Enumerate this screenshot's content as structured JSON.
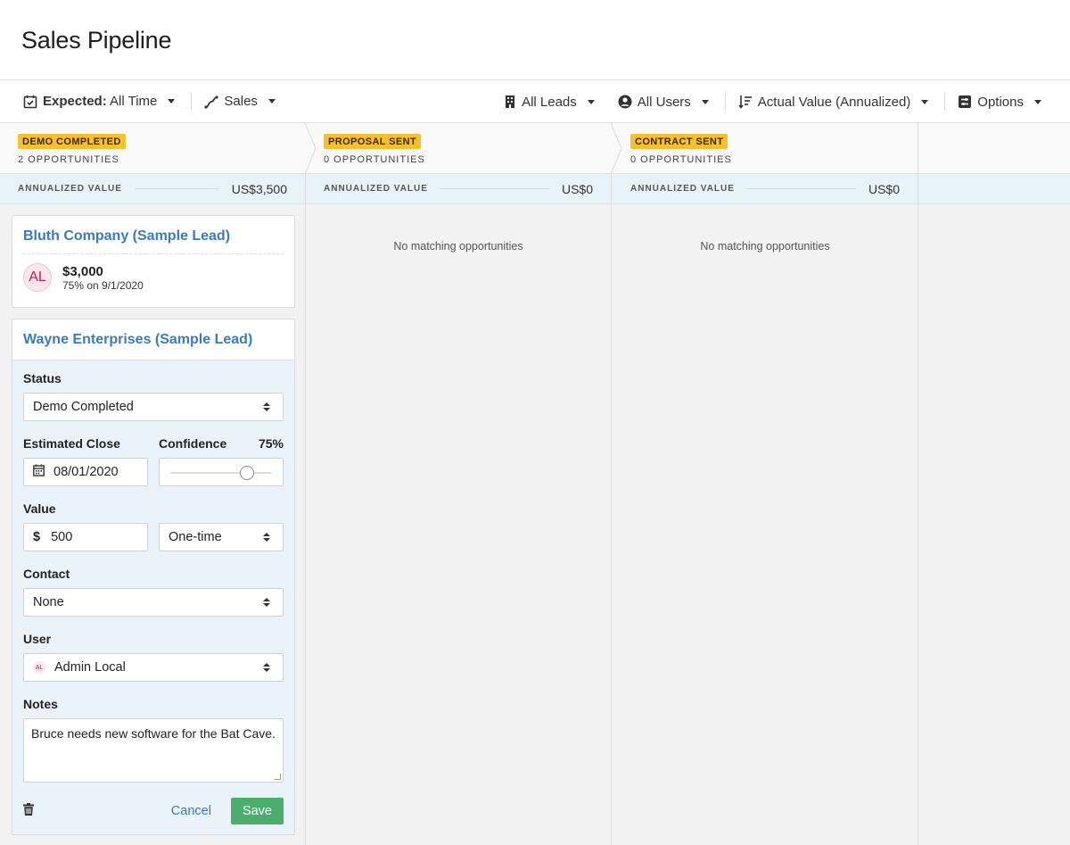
{
  "page": {
    "title": "Sales Pipeline"
  },
  "toolbar": {
    "expected_label": "Expected:",
    "expected_value": "All Time",
    "pipeline": "Sales",
    "leads": "All Leads",
    "users": "All Users",
    "sort": "Actual Value (Annualized)",
    "options": "Options"
  },
  "columns": [
    {
      "stage": "DEMO COMPLETED",
      "count": "2 OPPORTUNITIES",
      "value_label": "ANNUALIZED VALUE",
      "value": "US$3,500"
    },
    {
      "stage": "PROPOSAL SENT",
      "count": "0 OPPORTUNITIES",
      "value_label": "ANNUALIZED VALUE",
      "value": "US$0",
      "empty": "No matching opportunities"
    },
    {
      "stage": "CONTRACT SENT",
      "count": "0 OPPORTUNITIES",
      "value_label": "ANNUALIZED VALUE",
      "value": "US$0",
      "empty": "No matching opportunities"
    }
  ],
  "opportunity1": {
    "lead": "Bluth Company (Sample Lead)",
    "avatar": "AL",
    "amount": "$3,000",
    "detail": "75% on 9/1/2020"
  },
  "opportunity2": {
    "lead": "Wayne Enterprises (Sample Lead)",
    "form": {
      "status_label": "Status",
      "status_value": "Demo Completed",
      "close_label": "Estimated Close",
      "close_value": "08/01/2020",
      "confidence_label": "Confidence",
      "confidence_value": "75%",
      "confidence_fraction": 0.75,
      "value_label": "Value",
      "currency": "$",
      "value": "500",
      "period": "One-time",
      "contact_label": "Contact",
      "contact_value": "None",
      "user_label": "User",
      "user_avatar": "AL",
      "user_value": "Admin Local",
      "notes_label": "Notes",
      "notes_value": "Bruce needs new software for the Bat Cave.",
      "cancel": "Cancel",
      "save": "Save"
    }
  },
  "colors": {
    "stage_badge": "#f8bf2f",
    "link": "#3a7bbf",
    "save": "#4cae6c",
    "value_band": "#e8f2f9",
    "form_bg": "#eaf3fa"
  }
}
